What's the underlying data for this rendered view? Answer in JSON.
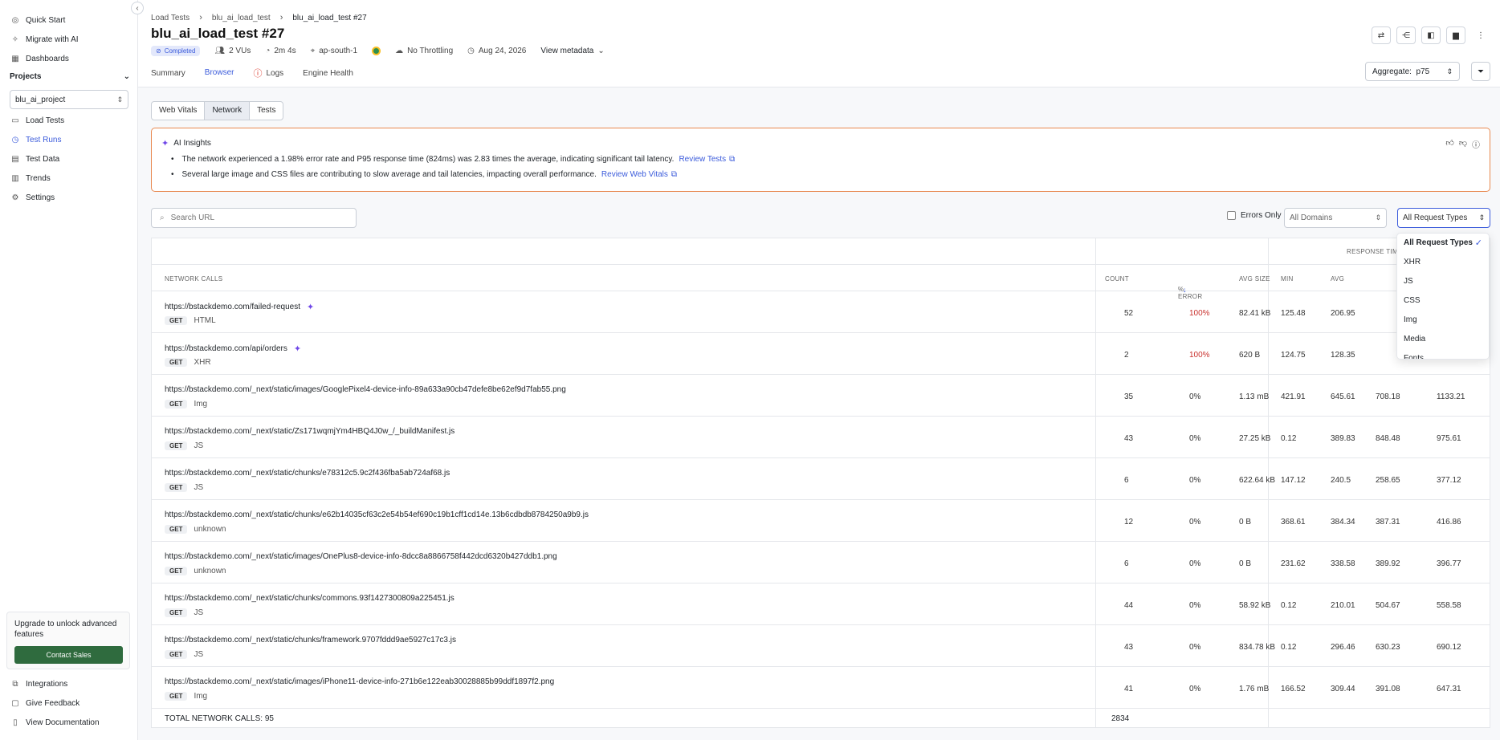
{
  "sidebar": {
    "top_items": [
      {
        "label": "Quick Start",
        "icon": "rocket-icon"
      },
      {
        "label": "Migrate with AI",
        "icon": "sparkle-icon"
      },
      {
        "label": "Dashboards",
        "icon": "dashboard-icon"
      }
    ],
    "projects_label": "Projects",
    "project_value": "blu_ai_project",
    "project_items": [
      {
        "label": "Load Tests",
        "icon": "list-icon"
      },
      {
        "label": "Test Runs",
        "icon": "run-icon",
        "active": true
      },
      {
        "label": "Test Data",
        "icon": "data-icon"
      },
      {
        "label": "Trends",
        "icon": "chart-icon"
      },
      {
        "label": "Settings",
        "icon": "gear-icon"
      }
    ],
    "upgrade_text": "Upgrade to unlock advanced features",
    "contact_label": "Contact Sales",
    "bottom_items": [
      {
        "label": "Integrations",
        "icon": "integrations-icon"
      },
      {
        "label": "Give Feedback",
        "icon": "feedback-icon"
      },
      {
        "label": "View Documentation",
        "icon": "docs-icon"
      }
    ]
  },
  "header": {
    "breadcrumb": [
      "Load Tests",
      "blu_ai_load_test",
      "blu_ai_load_test #27"
    ],
    "title": "blu_ai_load_test #27",
    "status": "Completed",
    "vus": "2 VUs",
    "duration": "2m 4s",
    "region": "ap-south-1",
    "throttling": "No Throttling",
    "date": "Aug 24, 2026",
    "view_metadata": "View metadata",
    "tabs": [
      "Summary",
      "Browser",
      "Logs",
      "Engine Health"
    ],
    "active_tab": "Browser",
    "aggregate_label": "Aggregate:",
    "aggregate_value": "p75"
  },
  "subtabs": [
    "Web Vitals",
    "Network",
    "Tests"
  ],
  "active_subtab": "Network",
  "insights": {
    "title": "AI Insights",
    "items": [
      {
        "text": "The network experienced a 1.98% error rate and P95 response time (824ms) was 2.83 times the average, indicating significant tail latency.",
        "link": "Review Tests"
      },
      {
        "text": "Several large image and CSS files are contributing to slow average and tail latencies, impacting overall performance.",
        "link": "Review Web Vitals"
      }
    ]
  },
  "filters": {
    "search_placeholder": "Search URL",
    "errors_only": "Errors Only",
    "domains": "All Domains",
    "request_types": "All Request Types"
  },
  "dropdown": {
    "options": [
      "All Request Types",
      "XHR",
      "JS",
      "CSS",
      "Img",
      "Media",
      "Fonts"
    ],
    "selected": "All Request Types"
  },
  "table": {
    "group_label": "RESPONSE TIME",
    "headers": {
      "calls": "NETWORK CALLS",
      "count": "COUNT",
      "error": "% ERROR",
      "size": "AVG SIZE",
      "min": "MIN",
      "avg": "AVG"
    },
    "rows": [
      {
        "url": "https://bstackdemo.com/failed-request",
        "method": "GET",
        "type": "HTML",
        "count": "52",
        "error": "100%",
        "size": "82.41 kB",
        "min": "125.48",
        "avg": "206.95",
        "p": "",
        "max": "",
        "ai": true
      },
      {
        "url": "https://bstackdemo.com/api/orders",
        "method": "GET",
        "type": "XHR",
        "count": "2",
        "error": "100%",
        "size": "620 B",
        "min": "124.75",
        "avg": "128.35",
        "p": "",
        "max": "",
        "ai": true
      },
      {
        "url": "https://bstackdemo.com/_next/static/images/GooglePixel4-device-info-89a633a90cb47defe8be62ef9d7fab55.png",
        "method": "GET",
        "type": "Img",
        "count": "35",
        "error": "0%",
        "size": "1.13 mB",
        "min": "421.91",
        "avg": "645.61",
        "p": "708.18",
        "max": "1133.21"
      },
      {
        "url": "https://bstackdemo.com/_next/static/Zs171wqmjYm4HBQ4J0w_/_buildManifest.js",
        "method": "GET",
        "type": "JS",
        "count": "43",
        "error": "0%",
        "size": "27.25 kB",
        "min": "0.12",
        "avg": "389.83",
        "p": "848.48",
        "max": "975.61"
      },
      {
        "url": "https://bstackdemo.com/_next/static/chunks/e78312c5.9c2f436fba5ab724af68.js",
        "method": "GET",
        "type": "JS",
        "count": "6",
        "error": "0%",
        "size": "622.64 kB",
        "min": "147.12",
        "avg": "240.5",
        "p": "258.65",
        "max": "377.12"
      },
      {
        "url": "https://bstackdemo.com/_next/static/chunks/e62b14035cf63c2e54b54ef690c19b1cff1cd14e.13b6cdbdb8784250a9b9.js",
        "method": "GET",
        "type": "unknown",
        "count": "12",
        "error": "0%",
        "size": "0 B",
        "min": "368.61",
        "avg": "384.34",
        "p": "387.31",
        "max": "416.86"
      },
      {
        "url": "https://bstackdemo.com/_next/static/images/OnePlus8-device-info-8dcc8a8866758f442dcd6320b427ddb1.png",
        "method": "GET",
        "type": "unknown",
        "count": "6",
        "error": "0%",
        "size": "0 B",
        "min": "231.62",
        "avg": "338.58",
        "p": "389.92",
        "max": "396.77"
      },
      {
        "url": "https://bstackdemo.com/_next/static/chunks/commons.93f1427300809a225451.js",
        "method": "GET",
        "type": "JS",
        "count": "44",
        "error": "0%",
        "size": "58.92 kB",
        "min": "0.12",
        "avg": "210.01",
        "p": "504.67",
        "max": "558.58"
      },
      {
        "url": "https://bstackdemo.com/_next/static/chunks/framework.9707fddd9ae5927c17c3.js",
        "method": "GET",
        "type": "JS",
        "count": "43",
        "error": "0%",
        "size": "834.78 kB",
        "min": "0.12",
        "avg": "296.46",
        "p": "630.23",
        "max": "690.12"
      },
      {
        "url": "https://bstackdemo.com/_next/static/images/iPhone11-device-info-271b6e122eab30028885b99ddf1897f2.png",
        "method": "GET",
        "type": "Img",
        "count": "41",
        "error": "0%",
        "size": "1.76 mB",
        "min": "166.52",
        "avg": "309.44",
        "p": "391.08",
        "max": "647.31"
      }
    ],
    "total_label": "TOTAL NETWORK CALLS: 95",
    "total_count": "2834"
  }
}
